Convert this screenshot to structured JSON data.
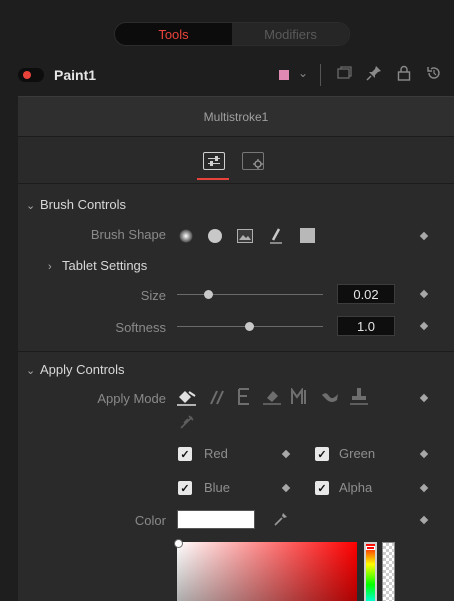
{
  "header": {
    "tabs": [
      {
        "label": "Tools",
        "active": true
      },
      {
        "label": "Modifiers",
        "active": false
      }
    ]
  },
  "node": {
    "name": "Paint1",
    "color_swatch": "#e08ab3",
    "icons": [
      "node-color-icon",
      "chevron-down-icon",
      "version-icon",
      "pin-icon",
      "lock-icon",
      "reset-icon"
    ]
  },
  "modifier": {
    "title": "Multistroke1"
  },
  "brush_controls": {
    "title": "Brush Controls",
    "brush_shape_label": "Brush Shape",
    "tablet_settings_label": "Tablet Settings",
    "size_label": "Size",
    "size_value": "0.02",
    "softness_label": "Softness",
    "softness_value": "1.0"
  },
  "apply_controls": {
    "title": "Apply Controls",
    "apply_mode_label": "Apply Mode",
    "channels": [
      {
        "label": "Red",
        "checked": true
      },
      {
        "label": "Green",
        "checked": true
      },
      {
        "label": "Blue",
        "checked": true
      },
      {
        "label": "Alpha",
        "checked": true
      }
    ],
    "color_label": "Color",
    "color_value": "#ffffff"
  },
  "accent_color": "#e8433a"
}
